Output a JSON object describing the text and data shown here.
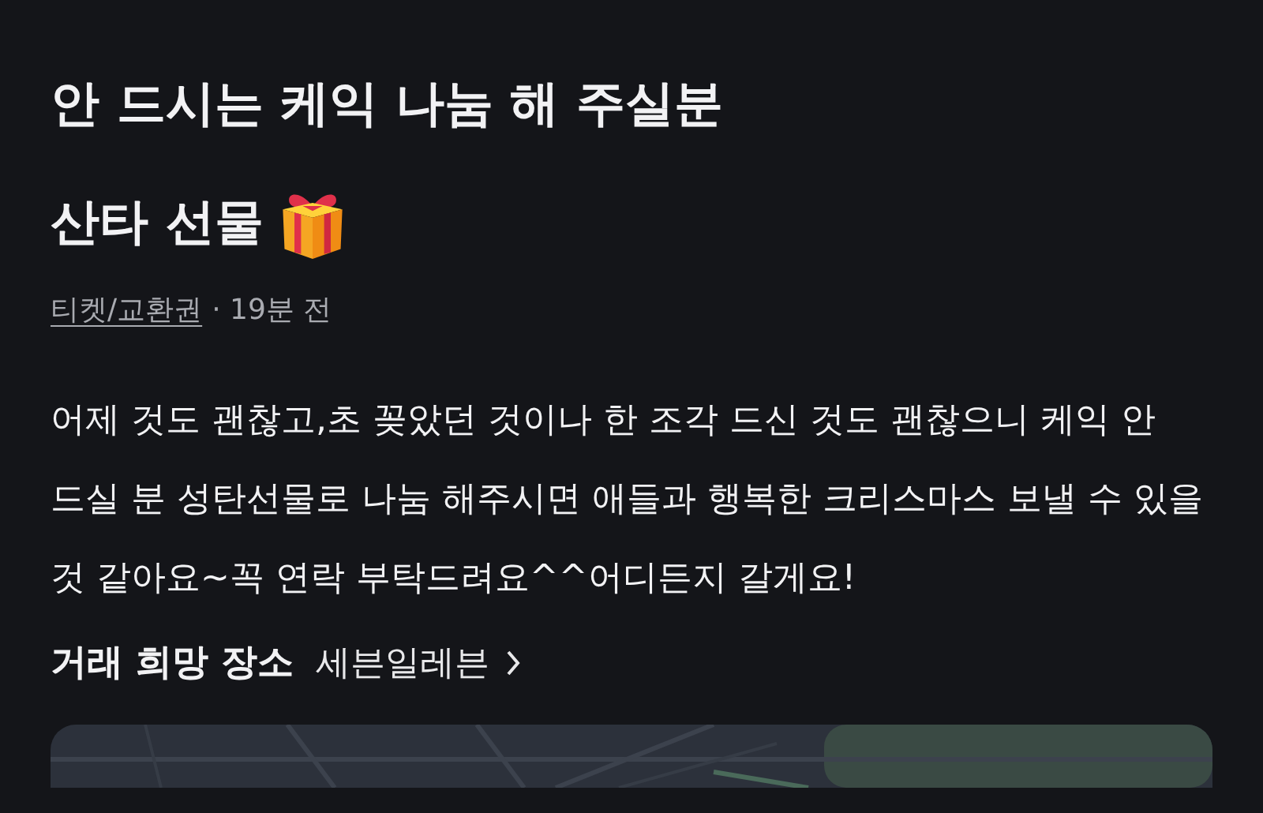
{
  "title_lines": [
    "안 드시는 케익 나눔 해 주실분",
    "산타 선물"
  ],
  "meta": {
    "category": "티켓/교환권",
    "time": "· 19분 전"
  },
  "description": "어제 것도 괜찮고,초 꽂았던 것이나 한 조각 드신 것도 괜찮으니 케익 안 드실 분 성탄선물로 나눔 해주시면 애들과 행복한 크리스마스 보낼 수 있을 것 같아요~꼭 연락 부탁드려요^^어디든지 갈게요!",
  "place": {
    "label": "거래 희망 장소",
    "value": "세븐일레븐"
  }
}
